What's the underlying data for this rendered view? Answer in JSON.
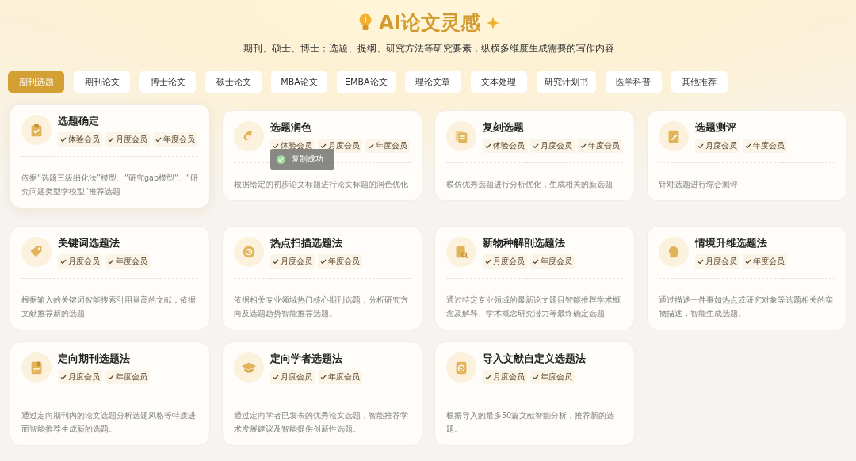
{
  "header": {
    "title": "AI论文灵感",
    "subtitle": "期刊、硕士、博士；选题、提纲、研究方法等研究要素，纵横多维度生成需要的写作内容"
  },
  "tabs": [
    {
      "label": "期刊选题",
      "selected": true
    },
    {
      "label": "期刊论文",
      "selected": false
    },
    {
      "label": "博士论文",
      "selected": false
    },
    {
      "label": "硕士论文",
      "selected": false
    },
    {
      "label": "MBA论文",
      "selected": false
    },
    {
      "label": "EMBA论文",
      "selected": false
    },
    {
      "label": "理论文章",
      "selected": false
    },
    {
      "label": "文本处理",
      "selected": false
    },
    {
      "label": "研究计划书",
      "selected": false
    },
    {
      "label": "医学科普",
      "selected": false
    },
    {
      "label": "其他推荐",
      "selected": false
    }
  ],
  "cards": [
    {
      "title": "选题确定",
      "hovered": true,
      "badges": [
        "体验会员",
        "月度会员",
        "年度会员"
      ],
      "description": "依据“选题三级细化法”模型、“研究gap模型“、“研究问题类型学模型”推荐选题"
    },
    {
      "title": "选题润色",
      "hovered": false,
      "badges": [
        "体验会员",
        "月度会员",
        "年度会员"
      ],
      "description": "根据给定的初步论文标题进行论文标题的润色优化",
      "toast": "复制成功"
    },
    {
      "title": "复刻选题",
      "hovered": false,
      "badges": [
        "体验会员",
        "月度会员",
        "年度会员"
      ],
      "description": "模仿优秀选题进行分析优化，生成相关的新选题"
    },
    {
      "title": "选题测评",
      "hovered": false,
      "badges": [
        "月度会员",
        "年度会员"
      ],
      "description": "针对选题进行综合测评"
    },
    {
      "title": "关键词选题法",
      "hovered": false,
      "badges": [
        "月度会员",
        "年度会员"
      ],
      "description": "根据输入的关键词智能搜索引用量高的文献，依据文献推荐新的选题"
    },
    {
      "title": "热点扫描选题法",
      "hovered": false,
      "badges": [
        "月度会员",
        "年度会员"
      ],
      "description": "依据相关专业领域热门核心期刊选题，分析研究方向及选题趋势智能推荐选题。"
    },
    {
      "title": "新物种解剖选题法",
      "hovered": false,
      "badges": [
        "月度会员",
        "年度会员"
      ],
      "description": "通过特定专业领域的最新论文题目智能推荐学术概念及解释、学术概念研究潜力等最终确定选题"
    },
    {
      "title": "情境升维选题法",
      "hovered": false,
      "badges": [
        "月度会员",
        "年度会员"
      ],
      "description": "通过描述一件事如热点或研究对象等选题相关的实物描述，智能生成选题。"
    },
    {
      "title": "定向期刊选题法",
      "hovered": false,
      "badges": [
        "月度会员",
        "年度会员"
      ],
      "description": "通过定向期刊内的论文选题分析选题风格等特质进而智能推荐生成新的选题。"
    },
    {
      "title": "定向学者选题法",
      "hovered": false,
      "badges": [
        "月度会员",
        "年度会员"
      ],
      "description": "通过定向学者已发表的优秀论文选题，智能推荐学术发展建议及智能提供创新性选题。"
    },
    {
      "title": "导入文献自定义选题法",
      "hovered": false,
      "badges": [
        "月度会员",
        "年度会员"
      ],
      "description": "根据导入的最多50篇文献智能分析，推荐新的选题。"
    }
  ]
}
